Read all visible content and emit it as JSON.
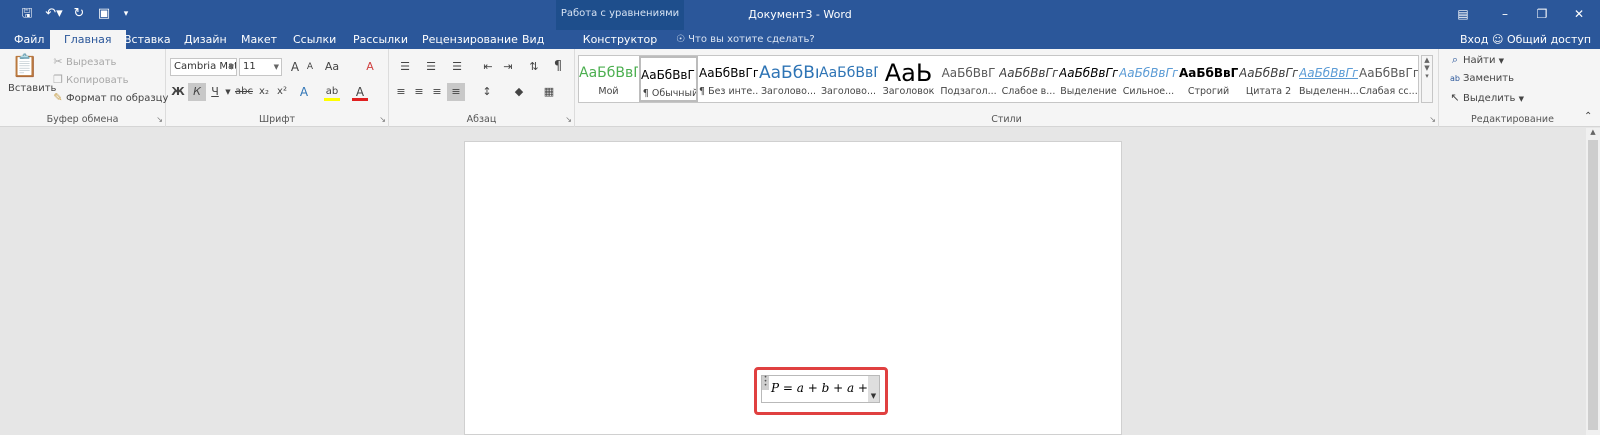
{
  "titlebar": {
    "document_title": "Документ3 - Word",
    "context_group": "Работа с уравнениями",
    "qat": [
      "save-icon",
      "undo-icon",
      "redo-icon",
      "touch-mode-icon",
      "customize-icon"
    ],
    "window_controls": [
      "ribbon-display-icon",
      "minimize-icon",
      "restore-icon",
      "close-icon"
    ]
  },
  "tabs": {
    "file": "Файл",
    "home": "Главная",
    "insert": "Вставка",
    "design": "Дизайн",
    "layout": "Макет",
    "references": "Ссылки",
    "mailings": "Рассылки",
    "review": "Рецензирование",
    "view": "Вид",
    "constructor": "Конструктор",
    "tell_me": "Что вы хотите сделать?",
    "sign_in": "Вход",
    "share": "Общий доступ"
  },
  "clipboard": {
    "paste": "Вставить",
    "cut": "Вырезать",
    "copy": "Копировать",
    "format_painter": "Формат по образцу",
    "group_label": "Буфер обмена"
  },
  "font": {
    "name": "Cambria Mat",
    "size": "11",
    "group_label": "Шрифт",
    "bold": "Ж",
    "italic": "К",
    "underline": "Ч",
    "strike": "abc",
    "subscript": "x₂",
    "superscript": "x²",
    "grow": "A",
    "shrink": "A",
    "case": "Aa",
    "clear": "A",
    "effects": "A",
    "highlight": "ab",
    "color": "A"
  },
  "paragraph": {
    "group_label": "Абзац",
    "pilcrow": "¶"
  },
  "styles": {
    "group_label": "Стили",
    "items": [
      {
        "preview": "АаБбВвГ",
        "name": "Мой",
        "color": "#4caf50"
      },
      {
        "preview": "АаБбВвГг,",
        "name": "¶ Обычный",
        "color": "#000000"
      },
      {
        "preview": "АаБбВвГг,",
        "name": "¶ Без инте...",
        "color": "#000000"
      },
      {
        "preview": "АаБбВı",
        "name": "Заголово...",
        "color": "#2e74b5"
      },
      {
        "preview": "АаБбВвГ",
        "name": "Заголово...",
        "color": "#2e74b5"
      },
      {
        "preview": "АаЬ",
        "name": "Заголовок",
        "color": "#000000"
      },
      {
        "preview": "АаБбВвГ",
        "name": "Подзагол...",
        "color": "#595959"
      },
      {
        "preview": "АаБбВвГг",
        "name": "Слабое в...",
        "color": "#404040"
      },
      {
        "preview": "АаБбВвГг",
        "name": "Выделение",
        "color": "#000000"
      },
      {
        "preview": "АаБбВвГг",
        "name": "Сильное...",
        "color": "#5b9bd5"
      },
      {
        "preview": "АаБбВвГг,",
        "name": "Строгий",
        "color": "#000000"
      },
      {
        "preview": "АаБбВвГг",
        "name": "Цитата 2",
        "color": "#404040"
      },
      {
        "preview": "АаБбВвГг",
        "name": "Выделенн...",
        "color": "#5b9bd5"
      },
      {
        "preview": "АаБбВвГг,",
        "name": "Слабая сс...",
        "color": "#595959"
      }
    ]
  },
  "editing": {
    "find": "Найти",
    "replace": "Заменить",
    "select": "Выделить",
    "group_label": "Редактирование"
  },
  "equation": {
    "text": "P = a + b + a + b"
  },
  "colors": {
    "accent": "#2b579a",
    "highlight_frame": "#e04040"
  }
}
